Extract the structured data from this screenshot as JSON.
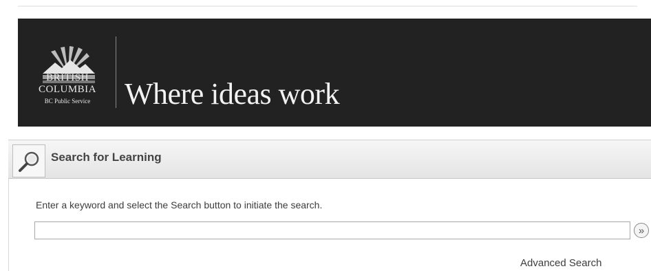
{
  "banner": {
    "logo": {
      "line1": "BRITISH",
      "line2": "COLUMBIA",
      "line3": "BC Public Service",
      "icon": "bc-sun-mountains-logo"
    },
    "tagline": "Where ideas work"
  },
  "search_panel": {
    "title": "Search for Learning",
    "icon": "magnifier-icon",
    "instructions": "Enter a keyword and select the Search button to initiate the search.",
    "input_value": "",
    "go_button_label": "»",
    "advanced_link": "Advanced Search"
  },
  "colors": {
    "banner_bg": "#222222",
    "panel_header_bg": "#eeeeee",
    "text": "#3c3c3c"
  }
}
